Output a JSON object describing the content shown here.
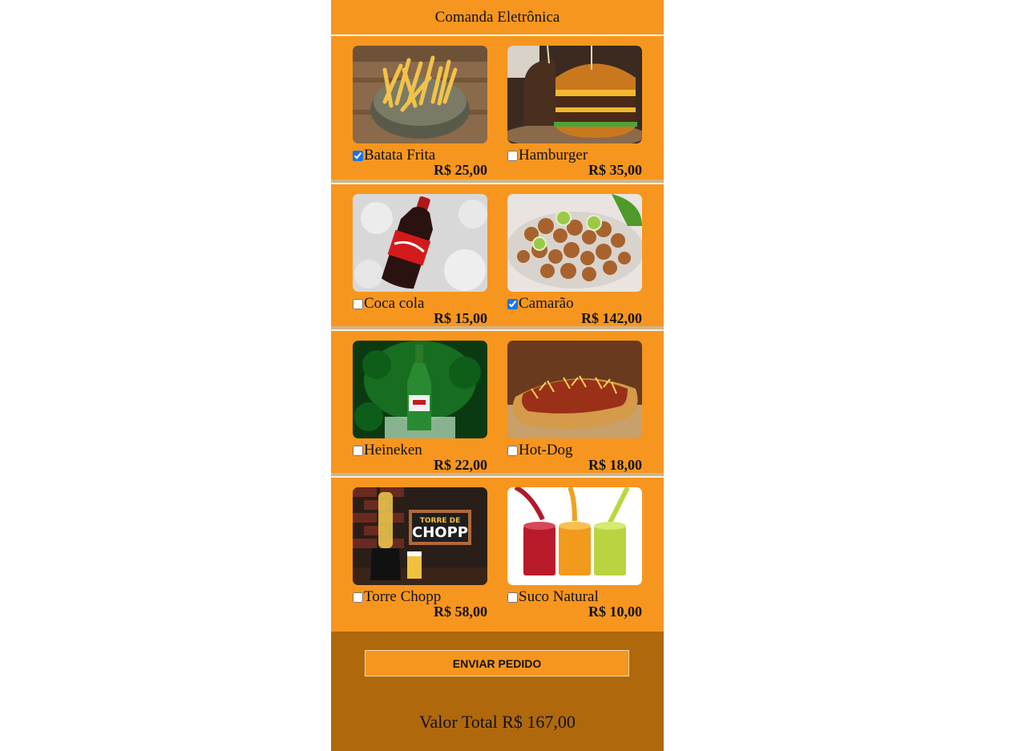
{
  "header": {
    "title": "Comanda Eletrônica"
  },
  "items": [
    {
      "name": "Batata Frita",
      "price": "R$ 25,00",
      "checked": true,
      "icon": "fries-photo"
    },
    {
      "name": "Hamburger",
      "price": "R$ 35,00",
      "checked": false,
      "icon": "burger-photo"
    },
    {
      "name": "Coca cola",
      "price": "R$ 15,00",
      "checked": false,
      "icon": "coke-photo"
    },
    {
      "name": "Camarão",
      "price": "R$ 142,00",
      "checked": true,
      "icon": "shrimp-photo"
    },
    {
      "name": "Heineken",
      "price": "R$ 22,00",
      "checked": false,
      "icon": "beer-photo"
    },
    {
      "name": "Hot-Dog",
      "price": "R$ 18,00",
      "checked": false,
      "icon": "hotdog-photo"
    },
    {
      "name": "Torre Chopp",
      "price": "R$ 58,00",
      "checked": false,
      "icon": "chopp-tower-photo"
    },
    {
      "name": "Suco Natural",
      "price": "R$ 10,00",
      "checked": false,
      "icon": "juice-photo"
    }
  ],
  "footer": {
    "send_label": "ENVIAR PEDIDO",
    "total_label": "Valor Total R$ 167,00"
  },
  "colors": {
    "panel": "#f7961e",
    "footer": "#b0680c",
    "checkbox_accent": "#1a73e8"
  }
}
